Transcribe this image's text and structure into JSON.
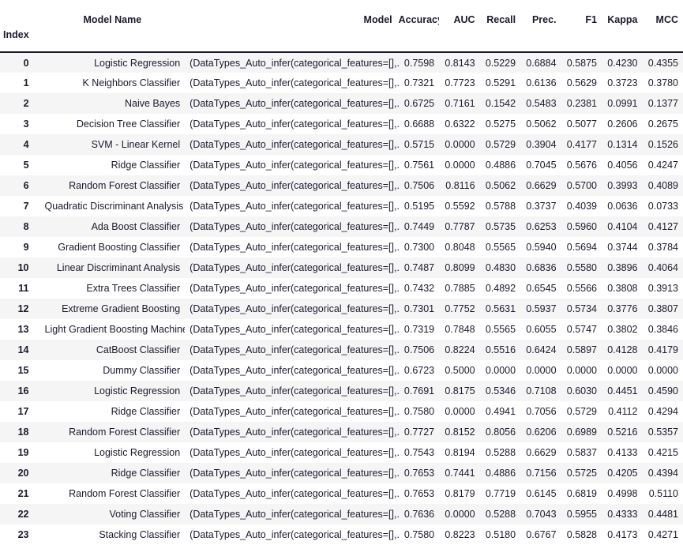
{
  "table": {
    "index_header": "Index",
    "columns": [
      {
        "key": "model_name",
        "label": "Model Name",
        "align": "right",
        "type": "text"
      },
      {
        "key": "model",
        "label": "Model",
        "align": "left",
        "type": "text"
      },
      {
        "key": "accuracy",
        "label": "Accuracy",
        "align": "right",
        "type": "number"
      },
      {
        "key": "auc",
        "label": "AUC",
        "align": "right",
        "type": "number"
      },
      {
        "key": "recall",
        "label": "Recall",
        "align": "right",
        "type": "number"
      },
      {
        "key": "prec",
        "label": "Prec.",
        "align": "right",
        "type": "number"
      },
      {
        "key": "f1",
        "label": "F1",
        "align": "right",
        "type": "number"
      },
      {
        "key": "kappa",
        "label": "Kappa",
        "align": "right",
        "type": "number"
      },
      {
        "key": "mcc",
        "label": "MCC",
        "align": "right",
        "type": "number"
      }
    ],
    "model_cell_text": "(DataTypes_Auto_infer(categorical_features=[],...",
    "stripe_color": "#f5f5f5",
    "text_color": "#1a1a2e",
    "rows": [
      {
        "index": "0",
        "model_name": "Logistic Regression",
        "model": "(DataTypes_Auto_infer(categorical_features=[],...",
        "accuracy": "0.7598",
        "auc": "0.8143",
        "recall": "0.5229",
        "prec": "0.6884",
        "f1": "0.5875",
        "kappa": "0.4230",
        "mcc": "0.4355"
      },
      {
        "index": "1",
        "model_name": "K Neighbors Classifier",
        "model": "(DataTypes_Auto_infer(categorical_features=[],...",
        "accuracy": "0.7321",
        "auc": "0.7723",
        "recall": "0.5291",
        "prec": "0.6136",
        "f1": "0.5629",
        "kappa": "0.3723",
        "mcc": "0.3780"
      },
      {
        "index": "2",
        "model_name": "Naive Bayes",
        "model": "(DataTypes_Auto_infer(categorical_features=[],...",
        "accuracy": "0.6725",
        "auc": "0.7161",
        "recall": "0.1542",
        "prec": "0.5483",
        "f1": "0.2381",
        "kappa": "0.0991",
        "mcc": "0.1377"
      },
      {
        "index": "3",
        "model_name": "Decision Tree Classifier",
        "model": "(DataTypes_Auto_infer(categorical_features=[],...",
        "accuracy": "0.6688",
        "auc": "0.6322",
        "recall": "0.5275",
        "prec": "0.5062",
        "f1": "0.5077",
        "kappa": "0.2606",
        "mcc": "0.2675"
      },
      {
        "index": "4",
        "model_name": "SVM - Linear Kernel",
        "model": "(DataTypes_Auto_infer(categorical_features=[],...",
        "accuracy": "0.5715",
        "auc": "0.0000",
        "recall": "0.5729",
        "prec": "0.3904",
        "f1": "0.4177",
        "kappa": "0.1314",
        "mcc": "0.1526"
      },
      {
        "index": "5",
        "model_name": "Ridge Classifier",
        "model": "(DataTypes_Auto_infer(categorical_features=[],...",
        "accuracy": "0.7561",
        "auc": "0.0000",
        "recall": "0.4886",
        "prec": "0.7045",
        "f1": "0.5676",
        "kappa": "0.4056",
        "mcc": "0.4247"
      },
      {
        "index": "6",
        "model_name": "Random Forest Classifier",
        "model": "(DataTypes_Auto_infer(categorical_features=[],...",
        "accuracy": "0.7506",
        "auc": "0.8116",
        "recall": "0.5062",
        "prec": "0.6629",
        "f1": "0.5700",
        "kappa": "0.3993",
        "mcc": "0.4089"
      },
      {
        "index": "7",
        "model_name": "Quadratic Discriminant Analysis",
        "model": "(DataTypes_Auto_infer(categorical_features=[],...",
        "accuracy": "0.5195",
        "auc": "0.5592",
        "recall": "0.5788",
        "prec": "0.3737",
        "f1": "0.4039",
        "kappa": "0.0636",
        "mcc": "0.0733"
      },
      {
        "index": "8",
        "model_name": "Ada Boost Classifier",
        "model": "(DataTypes_Auto_infer(categorical_features=[],...",
        "accuracy": "0.7449",
        "auc": "0.7787",
        "recall": "0.5735",
        "prec": "0.6253",
        "f1": "0.5960",
        "kappa": "0.4104",
        "mcc": "0.4127"
      },
      {
        "index": "9",
        "model_name": "Gradient Boosting Classifier",
        "model": "(DataTypes_Auto_infer(categorical_features=[],...",
        "accuracy": "0.7300",
        "auc": "0.8048",
        "recall": "0.5565",
        "prec": "0.5940",
        "f1": "0.5694",
        "kappa": "0.3744",
        "mcc": "0.3784"
      },
      {
        "index": "10",
        "model_name": "Linear Discriminant Analysis",
        "model": "(DataTypes_Auto_infer(categorical_features=[],...",
        "accuracy": "0.7487",
        "auc": "0.8099",
        "recall": "0.4830",
        "prec": "0.6836",
        "f1": "0.5580",
        "kappa": "0.3896",
        "mcc": "0.4064"
      },
      {
        "index": "11",
        "model_name": "Extra Trees Classifier",
        "model": "(DataTypes_Auto_infer(categorical_features=[],...",
        "accuracy": "0.7432",
        "auc": "0.7885",
        "recall": "0.4892",
        "prec": "0.6545",
        "f1": "0.5566",
        "kappa": "0.3808",
        "mcc": "0.3913"
      },
      {
        "index": "12",
        "model_name": "Extreme Gradient Boosting",
        "model": "(DataTypes_Auto_infer(categorical_features=[],...",
        "accuracy": "0.7301",
        "auc": "0.7752",
        "recall": "0.5631",
        "prec": "0.5937",
        "f1": "0.5734",
        "kappa": "0.3776",
        "mcc": "0.3807"
      },
      {
        "index": "13",
        "model_name": "Light Gradient Boosting Machine",
        "model": "(DataTypes_Auto_infer(categorical_features=[],...",
        "accuracy": "0.7319",
        "auc": "0.7848",
        "recall": "0.5565",
        "prec": "0.6055",
        "f1": "0.5747",
        "kappa": "0.3802",
        "mcc": "0.3846"
      },
      {
        "index": "14",
        "model_name": "CatBoost Classifier",
        "model": "(DataTypes_Auto_infer(categorical_features=[],...",
        "accuracy": "0.7506",
        "auc": "0.8224",
        "recall": "0.5516",
        "prec": "0.6424",
        "f1": "0.5897",
        "kappa": "0.4128",
        "mcc": "0.4179"
      },
      {
        "index": "15",
        "model_name": "Dummy Classifier",
        "model": "(DataTypes_Auto_infer(categorical_features=[],...",
        "accuracy": "0.6723",
        "auc": "0.5000",
        "recall": "0.0000",
        "prec": "0.0000",
        "f1": "0.0000",
        "kappa": "0.0000",
        "mcc": "0.0000"
      },
      {
        "index": "16",
        "model_name": "Logistic Regression",
        "model": "(DataTypes_Auto_infer(categorical_features=[],...",
        "accuracy": "0.7691",
        "auc": "0.8175",
        "recall": "0.5346",
        "prec": "0.7108",
        "f1": "0.6030",
        "kappa": "0.4451",
        "mcc": "0.4590"
      },
      {
        "index": "17",
        "model_name": "Ridge Classifier",
        "model": "(DataTypes_Auto_infer(categorical_features=[],...",
        "accuracy": "0.7580",
        "auc": "0.0000",
        "recall": "0.4941",
        "prec": "0.7056",
        "f1": "0.5729",
        "kappa": "0.4112",
        "mcc": "0.4294"
      },
      {
        "index": "18",
        "model_name": "Random Forest Classifier",
        "model": "(DataTypes_Auto_infer(categorical_features=[],...",
        "accuracy": "0.7727",
        "auc": "0.8152",
        "recall": "0.8056",
        "prec": "0.6206",
        "f1": "0.6989",
        "kappa": "0.5216",
        "mcc": "0.5357"
      },
      {
        "index": "19",
        "model_name": "Logistic Regression",
        "model": "(DataTypes_Auto_infer(categorical_features=[],...",
        "accuracy": "0.7543",
        "auc": "0.8194",
        "recall": "0.5288",
        "prec": "0.6629",
        "f1": "0.5837",
        "kappa": "0.4133",
        "mcc": "0.4215"
      },
      {
        "index": "20",
        "model_name": "Ridge Classifier",
        "model": "(DataTypes_Auto_infer(categorical_features=[],...",
        "accuracy": "0.7653",
        "auc": "0.7441",
        "recall": "0.4886",
        "prec": "0.7156",
        "f1": "0.5725",
        "kappa": "0.4205",
        "mcc": "0.4394"
      },
      {
        "index": "21",
        "model_name": "Random Forest Classifier",
        "model": "(DataTypes_Auto_infer(categorical_features=[],...",
        "accuracy": "0.7653",
        "auc": "0.8179",
        "recall": "0.7719",
        "prec": "0.6145",
        "f1": "0.6819",
        "kappa": "0.4998",
        "mcc": "0.5110"
      },
      {
        "index": "22",
        "model_name": "Voting Classifier",
        "model": "(DataTypes_Auto_infer(categorical_features=[],...",
        "accuracy": "0.7636",
        "auc": "0.0000",
        "recall": "0.5288",
        "prec": "0.7043",
        "f1": "0.5955",
        "kappa": "0.4333",
        "mcc": "0.4481"
      },
      {
        "index": "23",
        "model_name": "Stacking Classifier",
        "model": "(DataTypes_Auto_infer(categorical_features=[],...",
        "accuracy": "0.7580",
        "auc": "0.8223",
        "recall": "0.5180",
        "prec": "0.6767",
        "f1": "0.5828",
        "kappa": "0.4173",
        "mcc": "0.4271"
      }
    ]
  }
}
